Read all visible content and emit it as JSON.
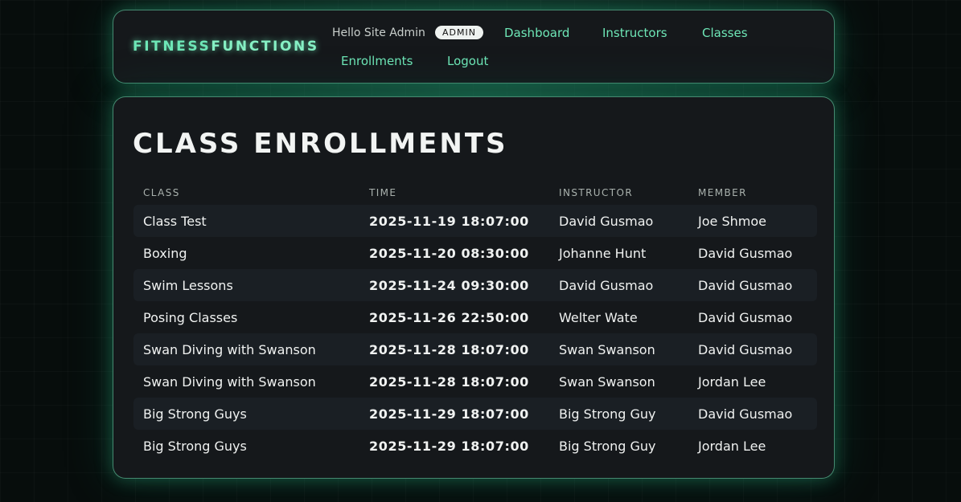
{
  "nav": {
    "brand_part1": "FITNESS",
    "brand_part2": "FUNCTIONS",
    "greeting": "Hello Site Admin",
    "role_badge": "ADMIN",
    "links": [
      "Dashboard",
      "Instructors",
      "Classes",
      "Enrollments",
      "Logout"
    ]
  },
  "page": {
    "title": "CLASS ENROLLMENTS"
  },
  "table": {
    "columns": [
      "CLASS",
      "TIME",
      "INSTRUCTOR",
      "MEMBER"
    ],
    "rows": [
      [
        "Class Test",
        "2025-11-19 18:07:00",
        "David Gusmao",
        "Joe Shmoe"
      ],
      [
        "Boxing",
        "2025-11-20 08:30:00",
        "Johanne Hunt",
        "David Gusmao"
      ],
      [
        "Swim Lessons",
        "2025-11-24 09:30:00",
        "David Gusmao",
        "David Gusmao"
      ],
      [
        "Posing Classes",
        "2025-11-26 22:50:00",
        "Welter Wate",
        "David Gusmao"
      ],
      [
        "Swan Diving with Swanson",
        "2025-11-28 18:07:00",
        "Swan Swanson",
        "David Gusmao"
      ],
      [
        "Swan Diving with Swanson",
        "2025-11-28 18:07:00",
        "Swan Swanson",
        "Jordan Lee"
      ],
      [
        "Big Strong Guys",
        "2025-11-29 18:07:00",
        "Big Strong Guy",
        "David Gusmao"
      ],
      [
        "Big Strong Guys",
        "2025-11-29 18:07:00",
        "Big Strong Guy",
        "Jordan Lee"
      ]
    ]
  },
  "colors": {
    "accent": "#6ee7b7",
    "card_bg": "#15181b",
    "page_bg": "#070d0c"
  }
}
